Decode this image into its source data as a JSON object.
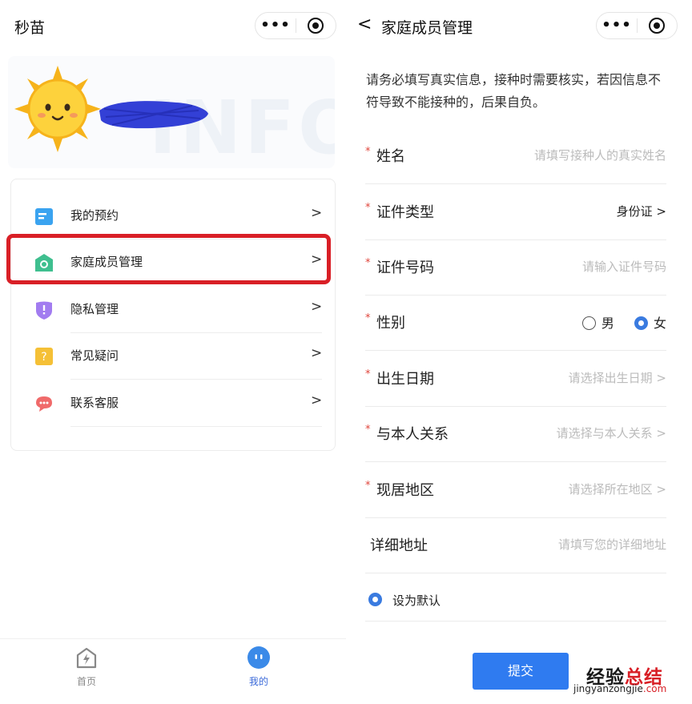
{
  "left": {
    "app_title": "秒苗",
    "capsule": {
      "more_icon": "more-dots-icon",
      "close_icon": "target-circle-icon"
    },
    "profile": {
      "watermark": "INFO",
      "avatar": "sun-avatar",
      "name_redacted": true
    },
    "menu": [
      {
        "label": "我的预约",
        "icon": "calendar-icon",
        "color": "#3aa3f0"
      },
      {
        "label": "家庭成员管理",
        "icon": "home-icon",
        "color": "#3fbf8f",
        "highlighted": true
      },
      {
        "label": "隐私管理",
        "icon": "shield-icon",
        "color": "#a27cf0"
      },
      {
        "label": "常见疑问",
        "icon": "question-icon",
        "color": "#f5c036"
      },
      {
        "label": "联系客服",
        "icon": "chat-icon",
        "color": "#f06a6a"
      }
    ],
    "highlight_color": "#d91f26",
    "tabs": [
      {
        "label": "首页",
        "icon": "lightning-house-icon"
      },
      {
        "label": "我的",
        "icon": "face-icon",
        "active": true
      }
    ]
  },
  "right": {
    "page_title": "家庭成员管理",
    "notice": "请务必填写真实信息，接种时需要核实，若因信息不符导致不能接种的，后果自负。",
    "form": [
      {
        "label": "姓名",
        "required": true,
        "placeholder": "请填写接种人的真实姓名"
      },
      {
        "label": "证件类型",
        "required": true,
        "value": "身份证",
        "arrow": ">"
      },
      {
        "label": "证件号码",
        "required": true,
        "placeholder": "请输入证件号码"
      },
      {
        "label": "性别",
        "required": true,
        "options": [
          "男",
          "女"
        ],
        "selected": "女"
      },
      {
        "label": "出生日期",
        "required": true,
        "placeholder": "请选择出生日期",
        "arrow": ">"
      },
      {
        "label": "与本人关系",
        "required": true,
        "placeholder": "请选择与本人关系",
        "arrow": ">"
      },
      {
        "label": "现居地区",
        "required": true,
        "placeholder": "请选择所在地区",
        "arrow": ">"
      },
      {
        "label": "详细地址",
        "required": false,
        "placeholder": "请填写您的详细地址"
      }
    ],
    "set_default": "设为默认",
    "submit": "提交",
    "accent": "#2f7bf0"
  },
  "watermark": {
    "brand_black": "经验",
    "brand_red": "总结",
    "url_black": "jingyanzongjie",
    "url_red": ".com"
  }
}
